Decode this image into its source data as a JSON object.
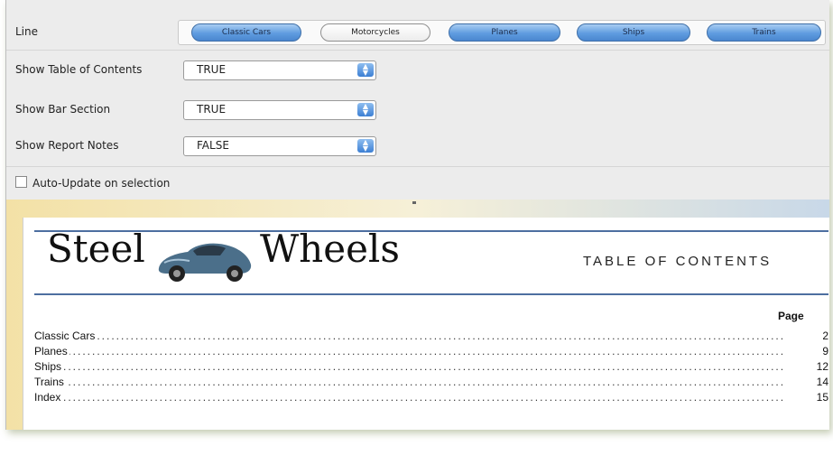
{
  "params": {
    "line": {
      "label": "Line",
      "options": [
        {
          "label": "Classic Cars",
          "selected": true
        },
        {
          "label": "Motorcycles",
          "selected": false
        },
        {
          "label": "Planes",
          "selected": true
        },
        {
          "label": "Ships",
          "selected": true
        },
        {
          "label": "Trains",
          "selected": true
        }
      ]
    },
    "show_toc": {
      "label": "Show Table of Contents",
      "value": "TRUE"
    },
    "show_bar": {
      "label": "Show Bar Section",
      "value": "TRUE"
    },
    "show_notes": {
      "label": "Show Report Notes",
      "value": "FALSE"
    },
    "auto_update": {
      "label": "Auto-Update on selection",
      "checked": false
    }
  },
  "report": {
    "logo_left": "Steel",
    "logo_right": "Wheels",
    "toc_title": "TABLE   OF   CONTENTS",
    "page_header": "Page",
    "toc": [
      {
        "name": "Classic Cars",
        "page": "2"
      },
      {
        "name": "Planes",
        "page": "9"
      },
      {
        "name": "Ships",
        "page": "12"
      },
      {
        "name": "Trains",
        "page": "14"
      },
      {
        "name": "Index",
        "page": "15"
      }
    ]
  },
  "colors": {
    "accent_blue": "#4d6fa0",
    "pill_selected": "#5f9ce0"
  }
}
